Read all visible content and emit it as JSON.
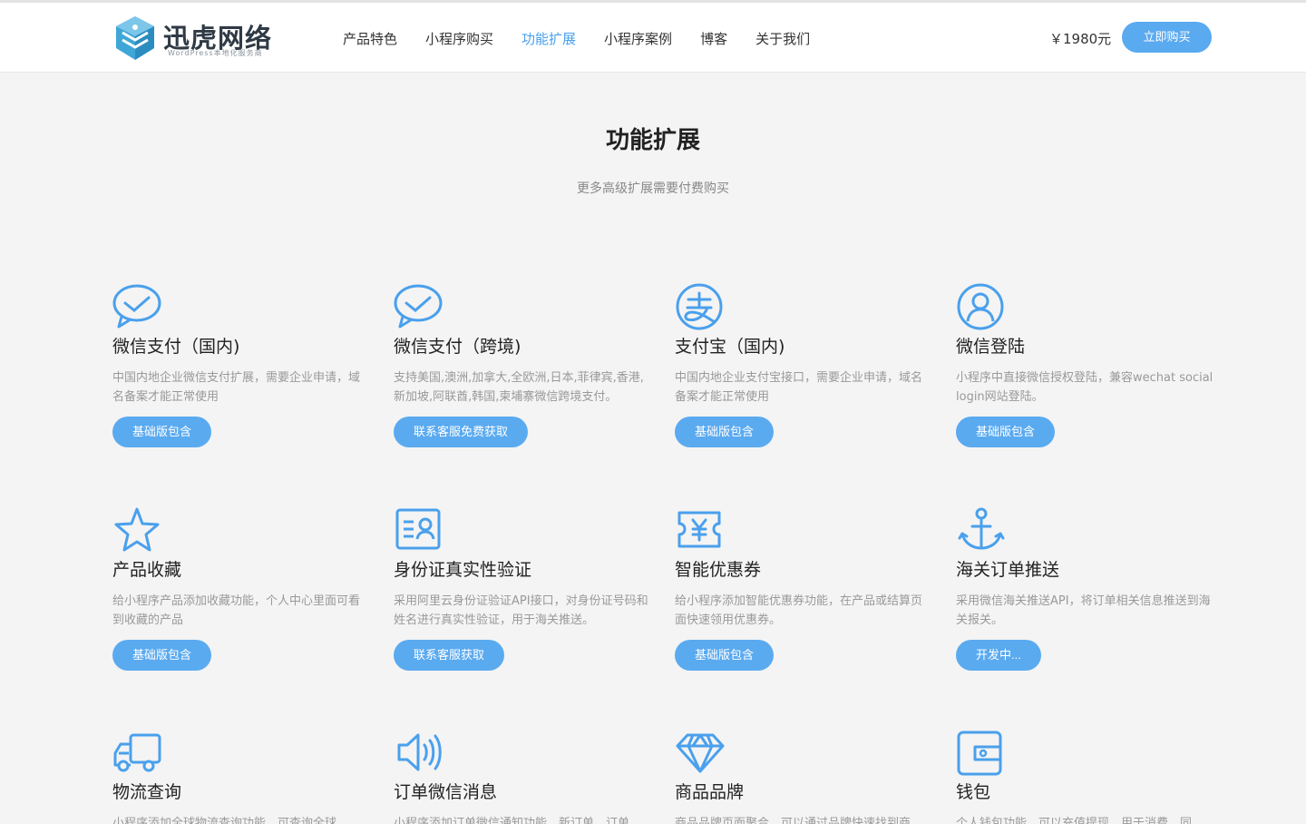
{
  "brand": {
    "name": "迅虎网络",
    "tagline": "WordPress本地化服务商"
  },
  "nav": {
    "items": [
      {
        "label": "产品特色"
      },
      {
        "label": "小程序购买"
      },
      {
        "label": "功能扩展"
      },
      {
        "label": "小程序案例"
      },
      {
        "label": "博客"
      },
      {
        "label": "关于我们"
      }
    ],
    "active": "功能扩展"
  },
  "header": {
    "price": "￥1980元",
    "buy_label": "立即购买"
  },
  "hero": {
    "title": "功能扩展",
    "subtitle": "更多高级扩展需要付费购买"
  },
  "colors": {
    "accent": "#5aaaf0",
    "nav_active": "#4aa0ec",
    "background": "#f4f4f4"
  },
  "features": [
    {
      "icon": "chat-bubble-icon",
      "title": "微信支付（国内)",
      "desc": "中国内地企业微信支付扩展，需要企业申请，域名备案才能正常使用",
      "button": "基础版包含"
    },
    {
      "icon": "chat-bubble-icon",
      "title": "微信支付（跨境)",
      "desc": "支持美国,澳洲,加拿大,全欧洲,日本,菲律宾,香港,新加坡,阿联酋,韩国,柬埔寨微信跨境支付。",
      "button": "联系客服免费获取"
    },
    {
      "icon": "alipay-icon",
      "title": "支付宝（国内)",
      "desc": "中国内地企业支付宝接口，需要企业申请，域名备案才能正常使用",
      "button": "基础版包含"
    },
    {
      "icon": "user-circle-icon",
      "title": "微信登陆",
      "desc": "小程序中直接微信授权登陆，兼容wechat social login网站登陆。",
      "button": "基础版包含"
    },
    {
      "icon": "star-icon",
      "title": "产品收藏",
      "desc": "给小程序产品添加收藏功能，个人中心里面可看到收藏的产品",
      "button": "基础版包含"
    },
    {
      "icon": "id-card-icon",
      "title": "身份证真实性验证",
      "desc": "采用阿里云身份证验证API接口，对身份证号码和姓名进行真实性验证，用于海关推送。",
      "button": "联系客服获取"
    },
    {
      "icon": "coupon-icon",
      "title": "智能优惠券",
      "desc": "给小程序添加智能优惠券功能，在产品或结算页面快速领用优惠券。",
      "button": "基础版包含"
    },
    {
      "icon": "anchor-icon",
      "title": "海关订单推送",
      "desc": "采用微信海关推送API，将订单相关信息推送到海关报关。",
      "button": "开发中..."
    },
    {
      "icon": "truck-icon",
      "title": "物流查询",
      "desc": "小程序添加全球物流查询功能，可查询全球",
      "button": ""
    },
    {
      "icon": "speaker-icon",
      "title": "订单微信消息",
      "desc": "小程序添加订单微信通知功能，新订单，订单",
      "button": ""
    },
    {
      "icon": "diamond-icon",
      "title": "商品品牌",
      "desc": "商品品牌页面聚合，可以通过品牌快速找到商",
      "button": ""
    },
    {
      "icon": "wallet-icon",
      "title": "钱包",
      "desc": "个人钱包功能，可以充值提现，用于消费，同",
      "button": ""
    }
  ]
}
